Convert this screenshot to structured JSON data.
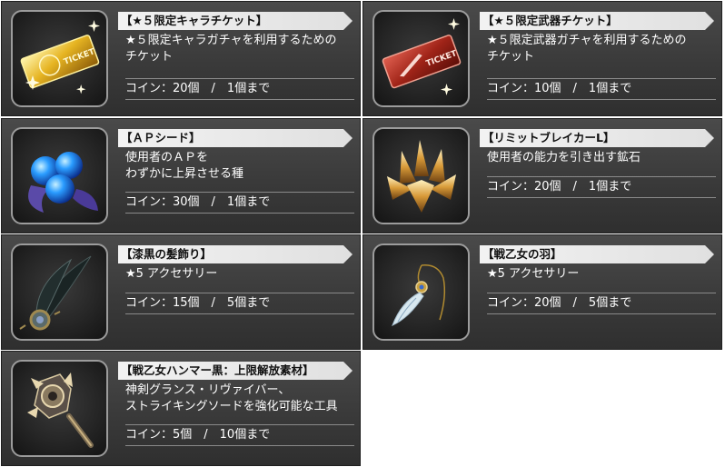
{
  "items": [
    {
      "title": "【★５限定キャラチケット】",
      "desc_lines": [
        "★５限定キャラガチャを利用するための",
        "チケット"
      ],
      "cost": "コイン：20個　/　1個まで",
      "icon": "gold-ticket-icon",
      "ticket_label": "TICKET"
    },
    {
      "title": "【★５限定武器チケット】",
      "desc_lines": [
        "★５限定武器ガチャを利用するための",
        "チケット"
      ],
      "cost": "コイン：10個　/　1個まで",
      "icon": "red-weapon-ticket-icon",
      "ticket_label": "TICKET"
    },
    {
      "title": "【ＡＰシード】",
      "desc_lines": [
        "使用者のＡＰを",
        "わずかに上昇させる種"
      ],
      "cost": "コイン：30個　/　1個まで",
      "icon": "blue-seed-icon"
    },
    {
      "title": "【リミットブレイカーL】",
      "desc_lines": [
        "使用者の能力を引き出す鉱石"
      ],
      "cost": "コイン：20個　/　1個まで",
      "icon": "crystal-ore-icon"
    },
    {
      "title": "【漆黒の髪飾り】",
      "desc_lines": [
        "★5 アクセサリー"
      ],
      "cost": "コイン：15個　/　5個まで",
      "icon": "black-feather-hairpin-icon"
    },
    {
      "title": "【戦乙女の羽】",
      "desc_lines": [
        "★5 アクセサリー"
      ],
      "cost": "コイン：20個　/　5個まで",
      "icon": "white-feather-necklace-icon"
    },
    {
      "title": "【戦乙女ハンマー黒：上限解放素材】",
      "desc_lines": [
        "神剣グランス・リヴァイバー、",
        "ストライキングソードを強化可能な工具"
      ],
      "cost": "コイン：5個　/　10個まで",
      "icon": "hammer-icon"
    }
  ],
  "colors": {
    "card_bg": "#3a3a3a",
    "title_band": "#eeeeee",
    "text": "#ffffff",
    "thumb_border": "#9c9c9c"
  }
}
